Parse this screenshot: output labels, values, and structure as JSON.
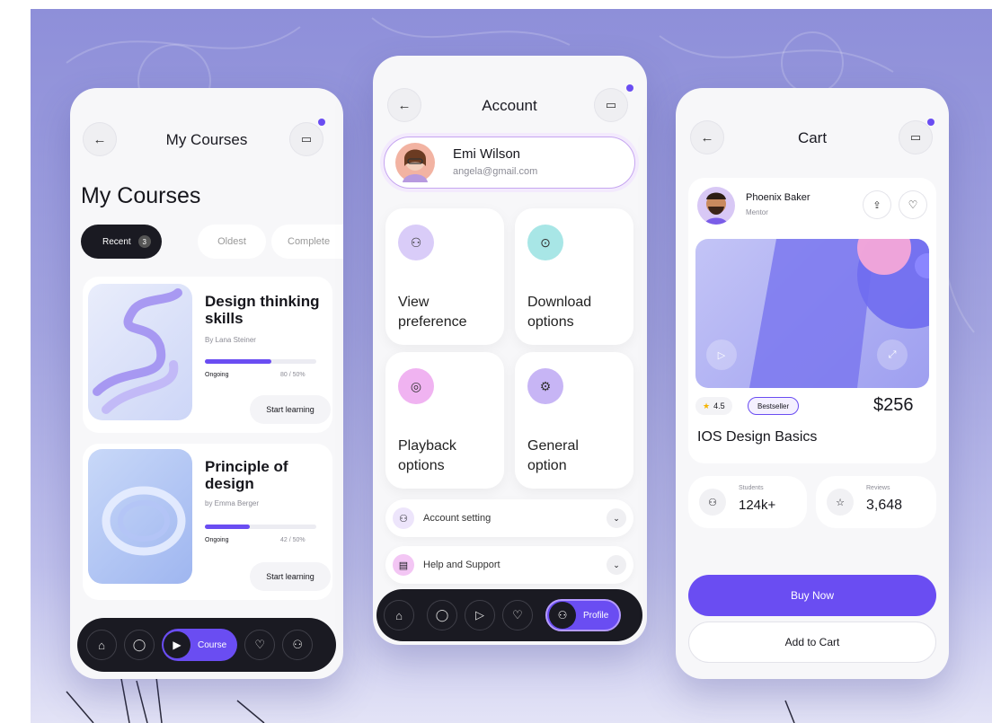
{
  "colors": {
    "accent": "#6a4df2",
    "dark": "#1a1a22",
    "background": "#9b9ddd",
    "lilac": "#d9ccf8",
    "teal": "#a8e6e6",
    "pink": "#f0b3f1",
    "lavender": "#c7b5f5"
  },
  "courses_screen": {
    "header_title": "My Courses",
    "page_title": "My Courses",
    "filters": [
      {
        "label": "Recent",
        "count": "3",
        "active": true
      },
      {
        "label": "Oldest"
      },
      {
        "label": "Complete"
      }
    ],
    "courses": [
      {
        "title": "Design thinking skills",
        "author": "By Lana Steiner",
        "status": "Ongoing",
        "progress_text": "80 / 50%",
        "progress": 0.6,
        "button": "Start learning"
      },
      {
        "title": "Principle of design",
        "author": "by Emma Berger",
        "status": "Ongoing",
        "progress_text": "42 / 50%",
        "progress": 0.4,
        "button": "Start learning"
      }
    ],
    "nav": {
      "active_label": "Course",
      "icons": [
        "home-icon",
        "search-icon",
        "play-icon",
        "heart-icon",
        "user-icon"
      ]
    }
  },
  "account_screen": {
    "header_title": "Account",
    "user": {
      "name": "Emi Wilson",
      "email": "angela@gmail.com"
    },
    "tiles": [
      {
        "label": "View\npreference",
        "icon": "user-settings-icon",
        "color": "#d9ccf8"
      },
      {
        "label": "Download\noptions",
        "icon": "download-icon",
        "color": "#a8e6e6"
      },
      {
        "label": "Playback\noptions",
        "icon": "playback-icon",
        "color": "#f0b3f1"
      },
      {
        "label": "General\noption",
        "icon": "settings-icon",
        "color": "#c7b5f5"
      }
    ],
    "rows": [
      {
        "label": "Account setting",
        "icon": "user-icon"
      },
      {
        "label": "Help and Support",
        "icon": "help-icon"
      }
    ],
    "nav": {
      "active_label": "Profile",
      "icons": [
        "home-icon",
        "search-icon",
        "play-icon",
        "heart-icon",
        "user-icon"
      ]
    }
  },
  "cart_screen": {
    "header_title": "Cart",
    "mentor": {
      "name": "Phoenix Baker",
      "role": "Mentor"
    },
    "rating": "4.5",
    "badge": "Bestseller",
    "price": "$256",
    "course_title": "IOS Design Basics",
    "stats": [
      {
        "label": "Students",
        "value": "124k+"
      },
      {
        "label": "Reviews",
        "value": "3,648"
      }
    ],
    "buy_button": "Buy Now",
    "cart_button": "Add to Cart"
  },
  "glyphs": {
    "back": "←",
    "cart": "🛒",
    "chevron": "⌄",
    "play": "▶",
    "star": "★",
    "heart": "♡",
    "home": "⌂",
    "search": "⌕",
    "user": "⚇",
    "gear": "⚙",
    "download": "⊙",
    "share": "⇪"
  }
}
